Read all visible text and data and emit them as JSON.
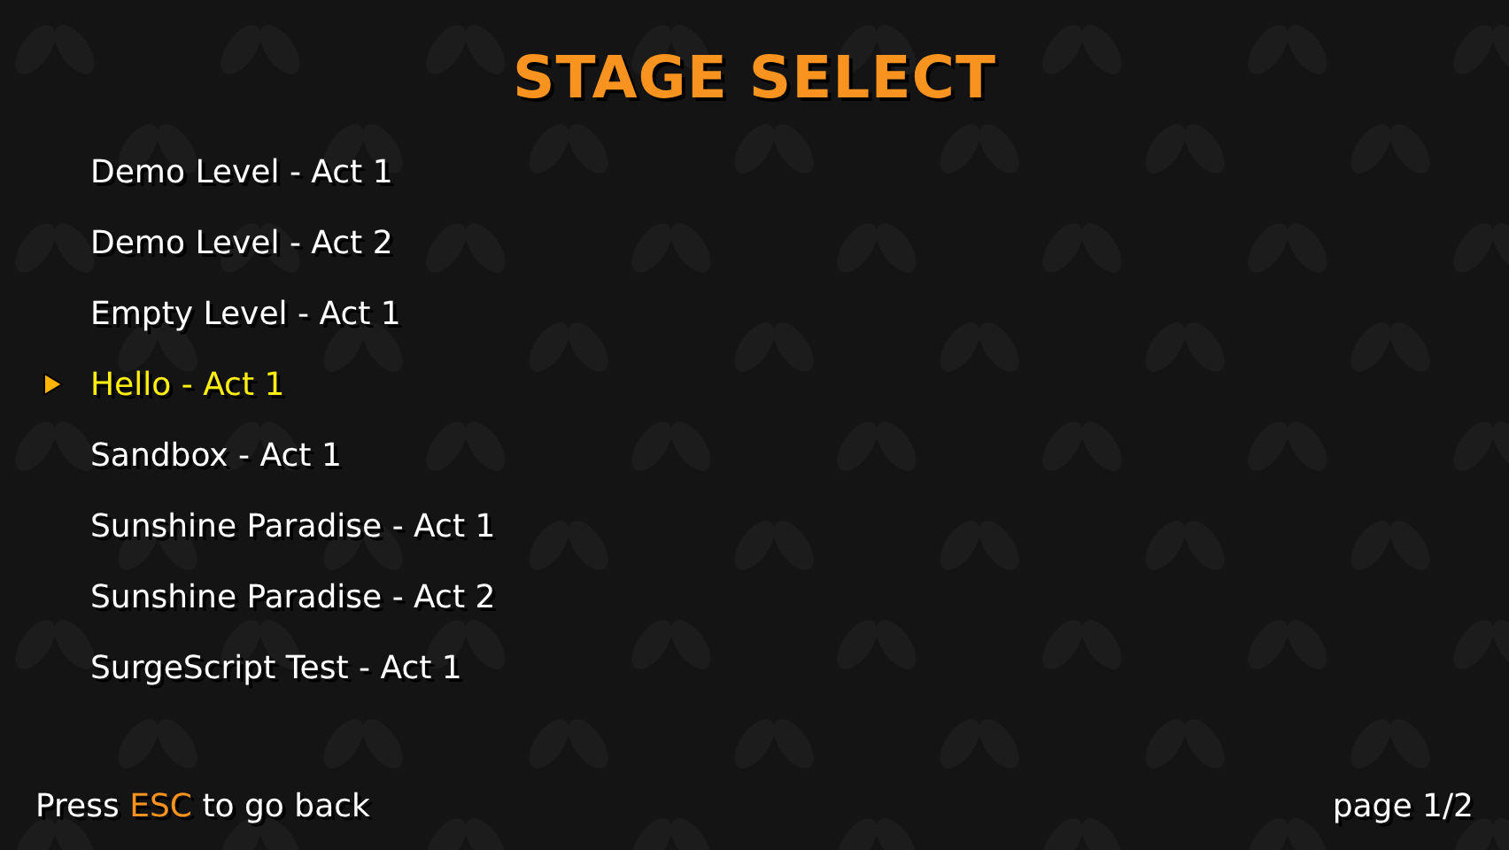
{
  "title": "STAGE SELECT",
  "stages": [
    {
      "label": "Demo Level - Act 1",
      "selected": false
    },
    {
      "label": "Demo Level - Act 2",
      "selected": false
    },
    {
      "label": "Empty Level - Act 1",
      "selected": false
    },
    {
      "label": "Hello - Act 1",
      "selected": true
    },
    {
      "label": "Sandbox - Act 1",
      "selected": false
    },
    {
      "label": "Sunshine Paradise - Act 1",
      "selected": false
    },
    {
      "label": "Sunshine Paradise - Act 2",
      "selected": false
    },
    {
      "label": "SurgeScript Test - Act 1",
      "selected": false
    }
  ],
  "footer": {
    "hint": "Press **ESC** to go back",
    "page": "page 1/2"
  }
}
